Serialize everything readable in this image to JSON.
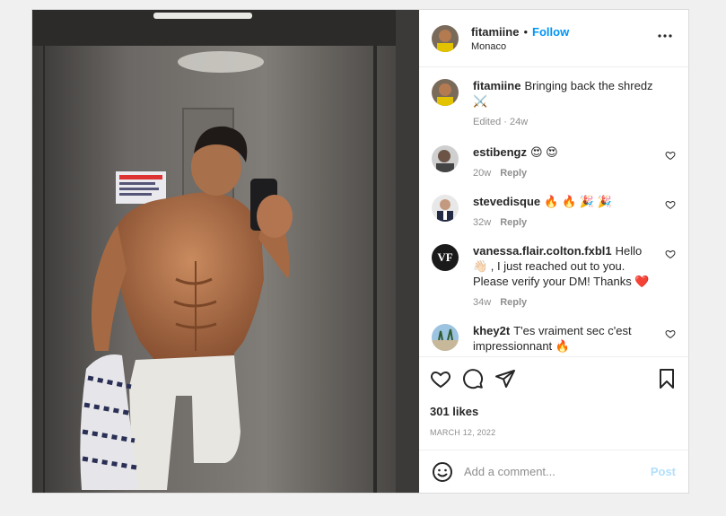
{
  "post": {
    "header": {
      "username": "fitamiine",
      "separator": "•",
      "follow_label": "Follow",
      "location": "Monaco",
      "more_icon": "more-horizontal-icon"
    },
    "caption": {
      "username": "fitamiine",
      "text": "Bringing back the shredz ⚔️",
      "meta": "Edited · 24w"
    },
    "comments": [
      {
        "username": "estibengz",
        "text": "😍 😍",
        "age": "20w",
        "reply_label": "Reply"
      },
      {
        "username": "stevedisque",
        "text": "🔥 🔥 🎉 🎉",
        "age": "32w",
        "reply_label": "Reply"
      },
      {
        "username": "vanessa.flair.colton.fxbl1",
        "text": "Hello 👋🏻 , I just reached out to you. Please verify your DM! Thanks ❤️",
        "age": "34w",
        "reply_label": "Reply",
        "avatar_text": "VF"
      },
      {
        "username": "khey2t",
        "text": "T'es vraiment sec c'est impressionnant 🔥"
      }
    ],
    "likes": "301 likes",
    "date": "MARCH 12, 2022",
    "add_comment": {
      "placeholder": "Add a comment...",
      "post_label": "Post",
      "emoji_icon": "emoji-icon"
    },
    "colors": {
      "accent": "#0095f6",
      "post_disabled": "#b2dffc",
      "meta_gray": "#8e8e8e"
    }
  }
}
